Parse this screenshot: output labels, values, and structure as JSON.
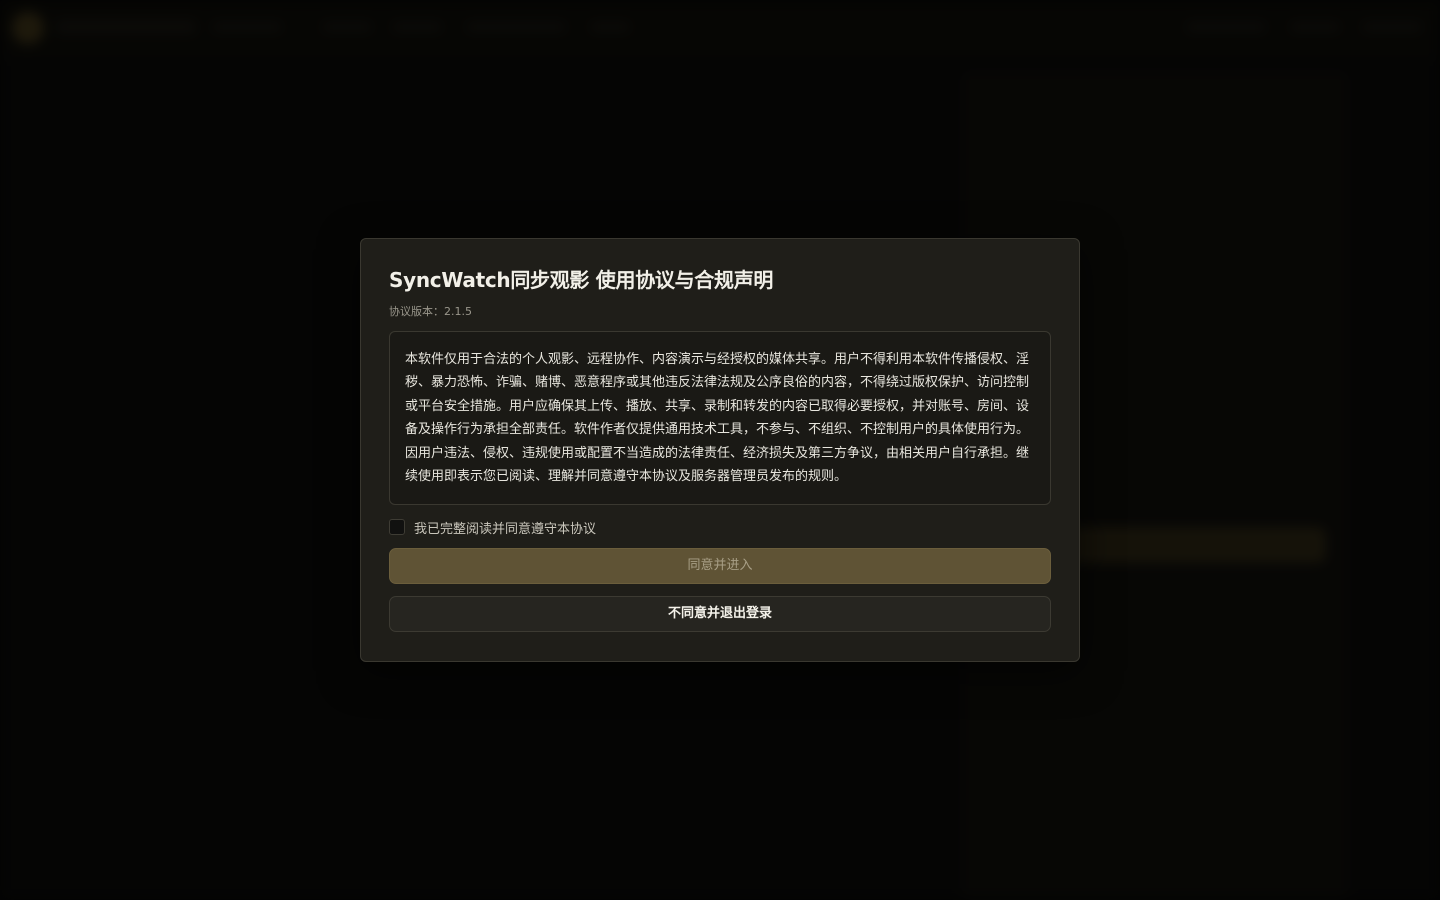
{
  "modal": {
    "title": "SyncWatch同步观影 使用协议与合规声明",
    "version_label": "协议版本：2.1.5",
    "agreement_text": "本软件仅用于合法的个人观影、远程协作、内容演示与经授权的媒体共享。用户不得利用本软件传播侵权、淫秽、暴力恐怖、诈骗、赌博、恶意程序或其他违反法律法规及公序良俗的内容，不得绕过版权保护、访问控制或平台安全措施。用户应确保其上传、播放、共享、录制和转发的内容已取得必要授权，并对账号、房间、设备及操作行为承担全部责任。软件作者仅提供通用技术工具，不参与、不组织、不控制用户的具体使用行为。因用户违法、侵权、违规使用或配置不当造成的法律责任、经济损失及第三方争议，由相关用户自行承担。继续使用即表示您已阅读、理解并同意遵守本协议及服务器管理员发布的规则。",
    "consent_label": "我已完整阅读并同意遵守本协议",
    "consent_checked": false,
    "agree_button": "同意并进入",
    "decline_button": "不同意并退出登录"
  },
  "colors": {
    "accent_disabled": "#5f5335",
    "modal_bg": "#1f1e19",
    "border": "#3a3830"
  }
}
